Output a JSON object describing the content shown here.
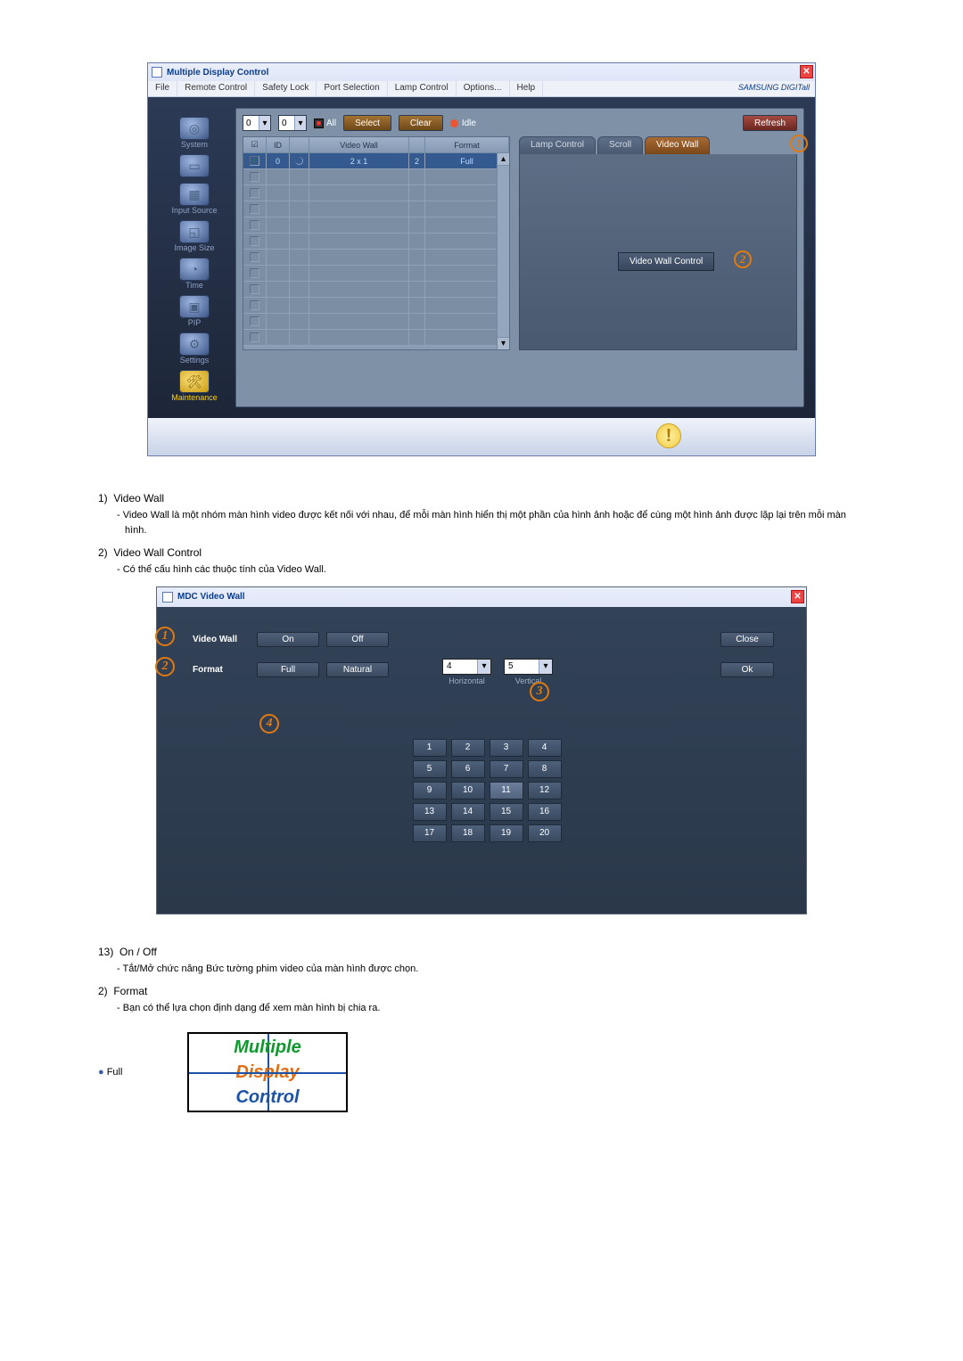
{
  "app1": {
    "title": "Multiple Display Control",
    "menu": [
      "File",
      "Remote Control",
      "Safety Lock",
      "Port Selection",
      "Lamp Control",
      "Options...",
      "Help"
    ],
    "brand": "SAMSUNG DIGITall",
    "selectFrom": "0",
    "selectTo": "0",
    "allLabel": "All",
    "btnSelect": "Select",
    "btnClear": "Clear",
    "idleLabel": "Idle",
    "btnRefresh": "Refresh",
    "sidebar": [
      "System",
      "",
      "Input Source",
      "Image Size",
      "Time",
      "PIP",
      "Settings",
      "Maintenance"
    ],
    "headers": {
      "chk": "☑",
      "id": "ID",
      "icon": "",
      "vw": "Video Wall",
      "n": "",
      "fmt": "Format"
    },
    "row0": {
      "id": "0",
      "vw": "2 x 1",
      "n": "2",
      "fmt": "Full"
    },
    "tabs": [
      "Lamp Control",
      "Scroll",
      "Video Wall"
    ],
    "vwcBtn": "Video Wall Control",
    "callout1": "1",
    "callout2": "2"
  },
  "desc1": [
    {
      "num": "1)",
      "title": "Video Wall",
      "body": "Video Wall là một nhóm màn hình video được kết nối với nhau, để mỗi màn hình hiển thị một phần của hình ảnh hoặc để cùng một hình ảnh được lặp lại trên mỗi màn hình."
    },
    {
      "num": "2)",
      "title": "Video Wall Control",
      "body": "Có thể cấu hình các thuộc tính của Video Wall."
    }
  ],
  "dialog": {
    "title": "MDC Video Wall",
    "labelVW": "Video Wall",
    "btnOn": "On",
    "btnOff": "Off",
    "btnClose": "Close",
    "labelFmt": "Format",
    "btnFull": "Full",
    "btnNatural": "Natural",
    "btnOk": "Ok",
    "hVal": "4",
    "hLabel": "Horizontal",
    "vVal": "5",
    "vLabel": "Vertical",
    "callouts": {
      "c1": "1",
      "c2": "2",
      "c3": "3",
      "c4": "4"
    },
    "grid": [
      [
        "1",
        "2",
        "3",
        "4"
      ],
      [
        "5",
        "6",
        "7",
        "8"
      ],
      [
        "9",
        "10",
        "11",
        "12"
      ],
      [
        "13",
        "14",
        "15",
        "16"
      ],
      [
        "17",
        "18",
        "19",
        "20"
      ]
    ]
  },
  "desc2": [
    {
      "num": "13)",
      "title": "On / Off",
      "body": "Tắt/Mở chức năng Bức tường phim video của màn hình được chọn."
    },
    {
      "num": "2)",
      "title": "Format",
      "body": "Bạn có thể lựa chọn định dạng để xem màn hình bị chia ra."
    }
  ],
  "full": {
    "label": "Full",
    "t1": "Multiple",
    "t2": "Display",
    "t3": "Control"
  }
}
